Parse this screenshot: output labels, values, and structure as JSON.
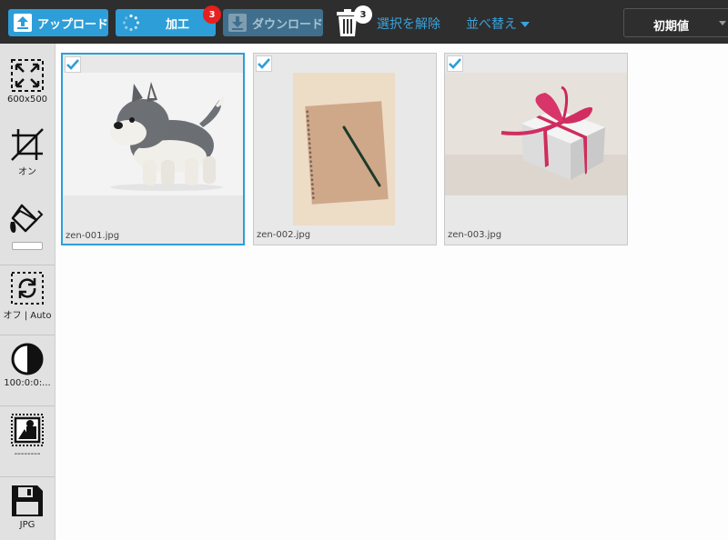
{
  "toolbar": {
    "upload_label": "アップロード",
    "process_label": "加工",
    "process_badge": "3",
    "download_label": "ダウンロード",
    "trash_badge": "3",
    "deselect_label": "選択を解除",
    "sort_label": "並べ替え",
    "preset_label": "初期値"
  },
  "sidebar": {
    "resize_caption": "600x500",
    "crop_caption": "オン",
    "rotate_caption": "オフ | Auto",
    "contrast_caption": "100:0:0:...",
    "frame_caption": "--------",
    "save_caption": "JPG"
  },
  "gallery": {
    "items": [
      {
        "filename": "zen-001.jpg",
        "selected": true
      },
      {
        "filename": "zen-002.jpg",
        "selected": false
      },
      {
        "filename": "zen-003.jpg",
        "selected": false
      }
    ]
  },
  "colors": {
    "accent": "#2d9ed8",
    "toolbar_bg": "#2e2e2e",
    "badge_red": "#e61f1f",
    "link": "#39a3dd"
  }
}
